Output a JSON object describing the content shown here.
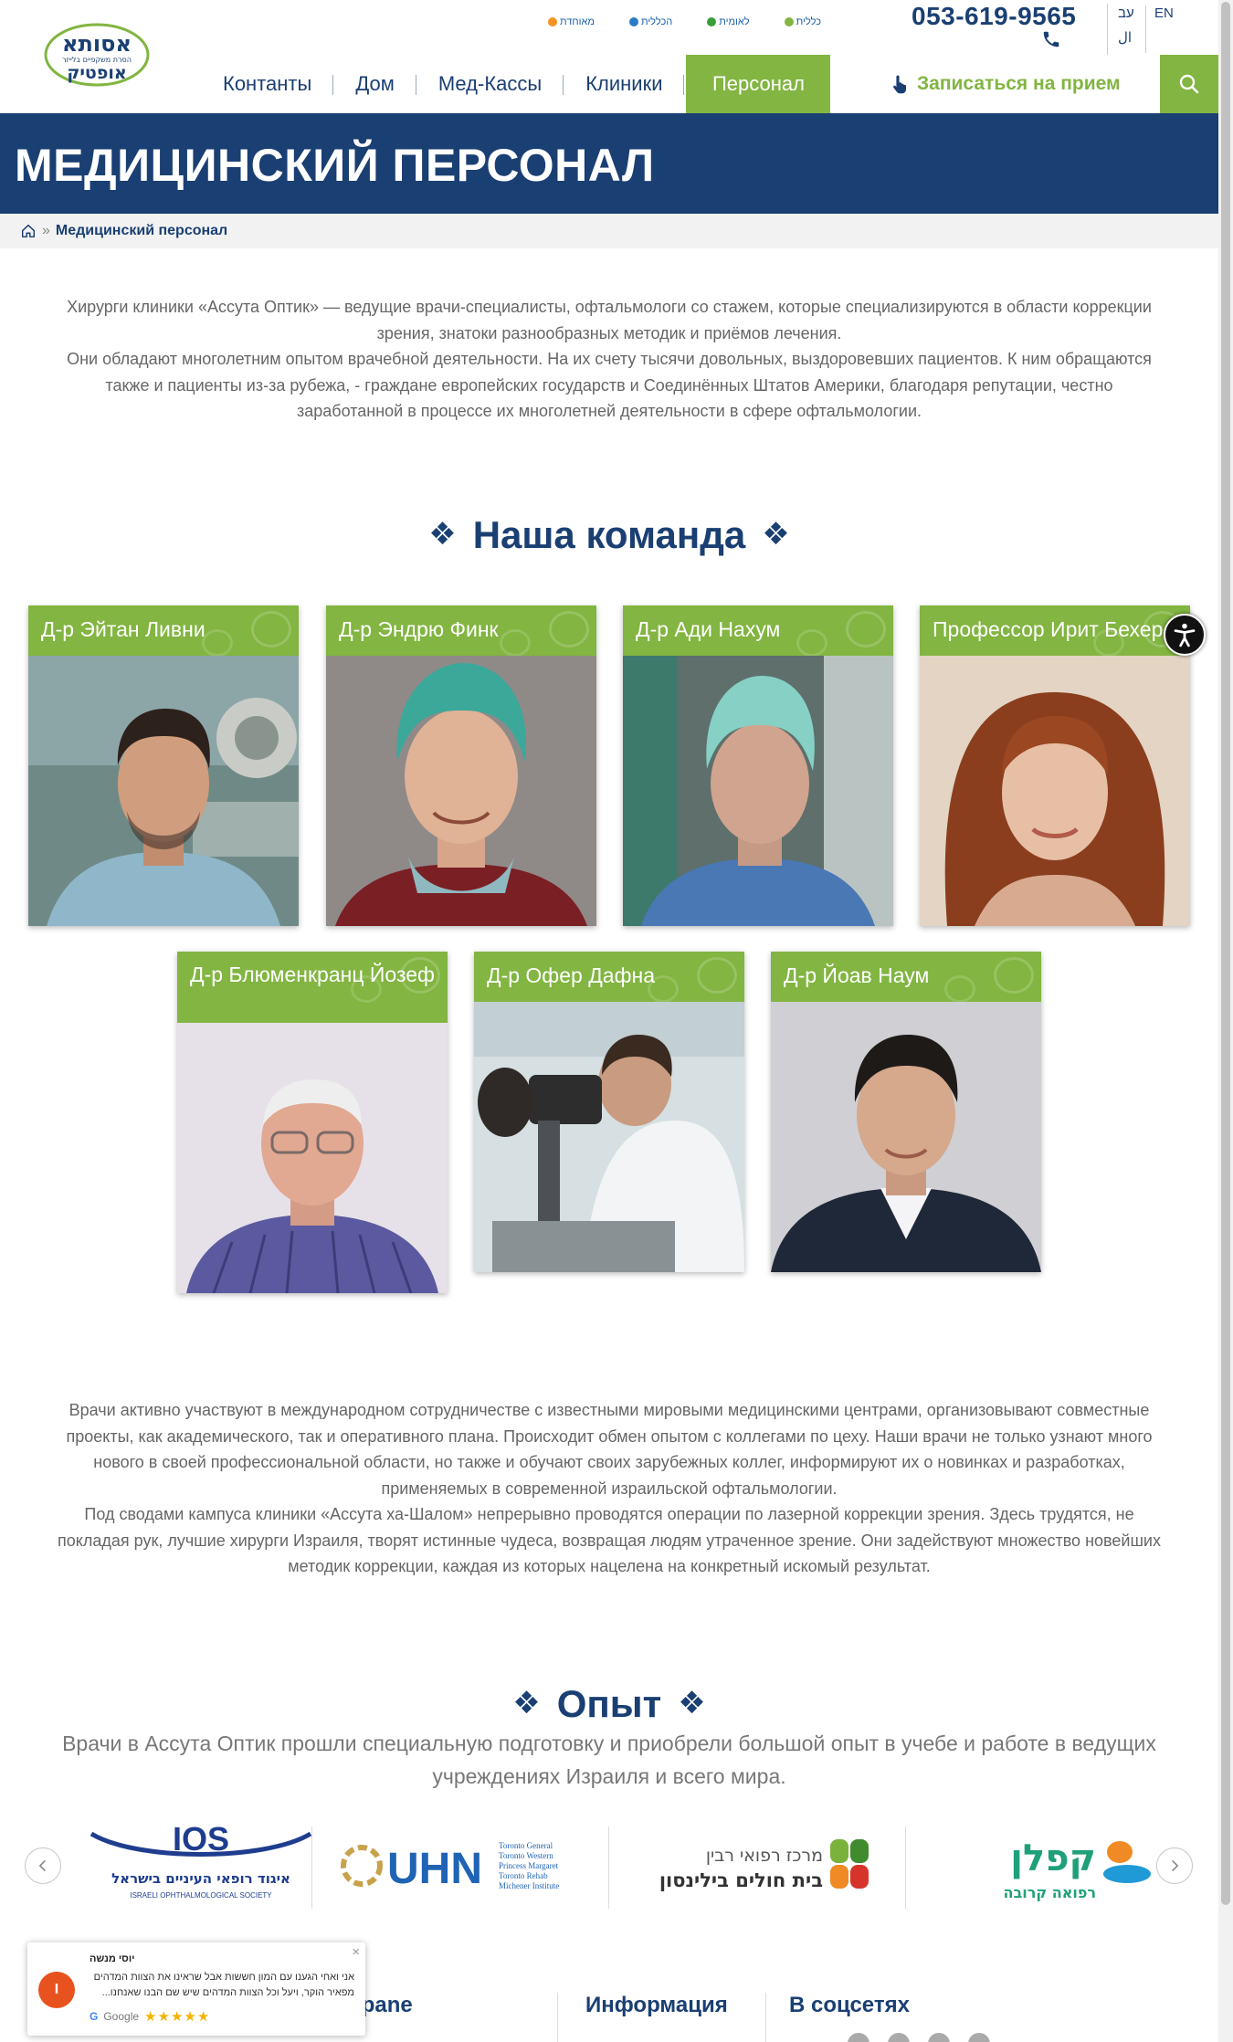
{
  "header": {
    "phone": "053-619-9565",
    "lang_he": "עב",
    "lang_en": "EN",
    "lang_ar": "ال",
    "health_funds": [
      "מאוחדת",
      "הכללית",
      "לאומית",
      "כללית"
    ],
    "nav": [
      "Контанты",
      "Дом",
      "Мед-Кассы",
      "Клиники",
      "Персонал"
    ],
    "book_label": "Записаться на прием"
  },
  "banner": {
    "title": "МЕДИЦИНСКИЙ ПЕРСОНАЛ"
  },
  "breadcrumb": {
    "separator": "»",
    "current": "Медицинский персонал"
  },
  "intro": {
    "p1": "Хирурги клиники «Ассута Оптик» — ведущие врачи-специалисты, офтальмологи со стажем, которые специализируются в области коррекции зрения, знатоки разнообразных методик и приёмов лечения.",
    "p2": "Они обладают многолетним опытом врачебной деятельности. На их счету тысячи довольных, выздоровевших пациентов. К ним обращаются также и пациенты из-за рубежа, - граждане европейских государств и Соединённых Штатов Америки, благодаря репутации, честно заработанной в процессе их многолетней деятельности в сфере офтальмологии."
  },
  "team": {
    "title": "Наша команда",
    "ornament": "❖",
    "doctors": [
      {
        "name": "Д-р Эйтан Ливни"
      },
      {
        "name": "Д-р Эндрю Финк"
      },
      {
        "name": "Д-р Ади Нахум"
      },
      {
        "name": "Профессор Ирит Бехер"
      },
      {
        "name": "Д-р Блюменкранц Йозеф"
      },
      {
        "name": "Д-р Офер Дафна"
      },
      {
        "name": "Д-р Йоав Наум"
      }
    ]
  },
  "body": {
    "p1": "Врачи активно участвуют в международном сотрудничестве с известными мировыми медицинскими центрами, организовывают совместные проекты, как академического, так и оперативного плана. Происходит обмен опытом с коллегами по цеху. Наши врачи не только узнают много нового в своей профессиональной области, но также и обучают своих зарубежных коллег, информируют их о новинках и разработках, применяемых в современной израильской офтальмологии.",
    "p2": "Под сводами кампуса клиники «Ассута ха-Шалом» непрерывно проводятся операции по лазерной коррекции зрения. Здесь трудятся, не покладая рук, лучшие хирурги Израиля, творят истинные чудеса, возвращая людям утраченное зрение. Они задействуют множество новейших методик коррекции, каждая из которых нацелена на конкретный искомый результат."
  },
  "experience": {
    "title": "Опыт",
    "subtitle": "Врачи в Ассута Оптик прошли специальную подготовку и приобрели большой опыт в учебе и работе в ведущих учреждениях Израиля и всего мира.",
    "partners": [
      {
        "top": "IOS",
        "bottom": "איגוד רופאי העיניים בישראל",
        "sub": "ISRAELI OPHTHALMOLOGICAL SOCIETY"
      },
      {
        "name": "UHN",
        "lines": [
          "Toronto General",
          "Toronto Western",
          "Princess Margaret",
          "Toronto Rehab",
          "Michener Institute"
        ]
      },
      {
        "line1": "מרכז רפואי רבין",
        "line2": "בית חולים בילינסון"
      },
      {
        "line1": "קפלן",
        "line2": "רפואה קרובה"
      }
    ]
  },
  "footer": {
    "col1": "трane",
    "col2": "Информация",
    "col3": "В соцсетях"
  },
  "review": {
    "avatar_letter": "I",
    "name": "יוסי מנשה",
    "line1": "אני ואחי הגענו עם המון חששות אבל שראינו את הצוות המדהים",
    "line2": "מפאיר הוקר, ויעל וכל הצוות המדהים שיש שם הבנו שאנחנו...",
    "source": "Google",
    "stars": "★★★★★",
    "close": "×"
  },
  "colors": {
    "navy": "#1a3f73",
    "green": "#82b541"
  }
}
